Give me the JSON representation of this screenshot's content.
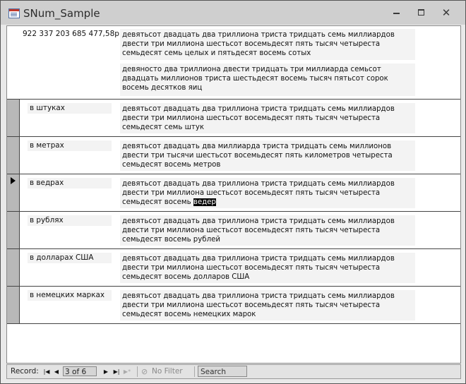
{
  "window": {
    "title": "SNum_Sample",
    "buttons": [
      "minimize",
      "maximize",
      "close"
    ]
  },
  "header": {
    "number": "922 337 203 685 477,58р.",
    "text_words": "девятьсот двадцать два триллиона триста тридцать семь миллиардов двести три миллиона шестьсот восемьдесят пять тысяч четыреста семьдесят семь целых и пятьдесят восемь сотых",
    "text_eggs": "девяносто два триллиона двести тридцать три миллиарда семьсот двадцать миллионов триста шестьдесят восемь тысяч пятьсот сорок восемь десятков яиц"
  },
  "rows": [
    {
      "unit": "в штуках",
      "text": "девятьсот двадцать два триллиона триста тридцать семь миллиардов двести три миллиона шестьсот восемьдесят пять тысяч четыреста семьдесят семь штук"
    },
    {
      "unit": "в метрах",
      "text": "девятьсот двадцать два миллиарда триста тридцать семь миллионов двести три тысячи шестьсот восемьдесят пять километров четыреста семьдесят восемь метров"
    },
    {
      "unit": "в ведрах",
      "text_main": "девятьсот двадцать два триллиона триста тридцать семь миллиардов двести три миллиона шестьсот восемьдесят пять тысяч четыреста семьдесят восемь",
      "text_selected": "ведер",
      "current": true
    },
    {
      "unit": "в рублях",
      "text": "девятьсот двадцать два триллиона триста тридцать семь миллиардов двести три миллиона шестьсот восемьдесят пять тысяч четыреста семьдесят восемь рублей"
    },
    {
      "unit": "в долларах США",
      "text": "девятьсот двадцать два триллиона триста тридцать семь миллиардов двести три миллиона шестьсот восемьдесят пять тысяч четыреста семьдесят восемь долларов США"
    },
    {
      "unit": "в немецких марках",
      "text": "девятьсот двадцать два триллиона триста тридцать семь миллиардов двести три миллиона шестьсот восемьдесят пять тысяч четыреста семьдесят восемь немецких марок"
    }
  ],
  "navbar": {
    "label": "Record:",
    "first_icon": "first-record-icon",
    "prev_icon": "previous-record-icon",
    "position": "3 of 6",
    "next_icon": "next-record-icon",
    "last_icon": "last-record-icon",
    "new_icon": "new-record-icon",
    "filter_icon": "filter-icon",
    "filter_label": "No Filter",
    "search_placeholder": "Search"
  }
}
